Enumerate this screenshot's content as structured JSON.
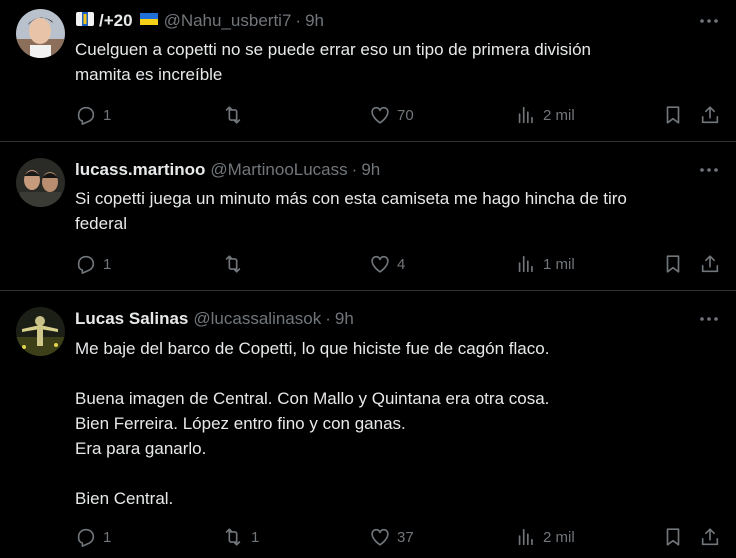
{
  "tweets": [
    {
      "display_name": "/+20",
      "handle": "@Nahu_usberti7",
      "time": "9h",
      "lines": [
        "Cuelguen a copetti no se puede errar eso un tipo de primera división",
        "mamita es increíble"
      ],
      "replies": "1",
      "retweets": "",
      "likes": "70",
      "views": "2 mil"
    },
    {
      "display_name": "lucass.martinoo",
      "handle": "@MartinooLucass",
      "time": "9h",
      "lines": [
        "Si copetti juega un minuto más con esta camiseta me hago hincha de tiro",
        "federal"
      ],
      "replies": "1",
      "retweets": "",
      "likes": "4",
      "views": "1 mil"
    },
    {
      "display_name": "Lucas Salinas",
      "handle": "@lucassalinasok",
      "time": "9h",
      "lines": [
        "Me baje del barco de Copetti, lo que hiciste fue de cagón flaco.",
        "",
        "Buena imagen de Central. Con Mallo y Quintana era otra cosa.",
        "Bien Ferreira. López entro fino y con ganas.",
        "Era para ganarlo.",
        "",
        "Bien Central."
      ],
      "replies": "1",
      "retweets": "1",
      "likes": "37",
      "views": "2 mil"
    }
  ],
  "separator": "·",
  "colors": {
    "background": "#000000",
    "text": "#e7e9ea",
    "muted": "#71767b",
    "border": "#2f3336"
  }
}
